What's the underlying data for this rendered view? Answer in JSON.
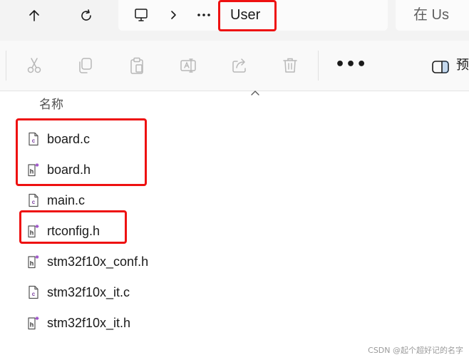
{
  "address_bar": {
    "back_icon": "arrow-up-icon",
    "refresh_icon": "refresh-icon",
    "current_folder": "User"
  },
  "search": {
    "placeholder": "在 Us"
  },
  "toolbar": {
    "more_label": "•••",
    "preview_label": "预"
  },
  "file_list": {
    "column_header": "名称",
    "files": [
      {
        "name": "board.c",
        "type": "c"
      },
      {
        "name": "board.h",
        "type": "h"
      },
      {
        "name": "main.c",
        "type": "c"
      },
      {
        "name": "rtconfig.h",
        "type": "h"
      },
      {
        "name": "stm32f10x_conf.h",
        "type": "h"
      },
      {
        "name": "stm32f10x_it.c",
        "type": "c"
      },
      {
        "name": "stm32f10x_it.h",
        "type": "h"
      }
    ]
  },
  "watermark": "CSDN @起个超好记的名字",
  "colors": {
    "highlight": "#ee1111",
    "c_icon": "#7b3fa0",
    "h_icon_spark": "#9b4fc8"
  }
}
